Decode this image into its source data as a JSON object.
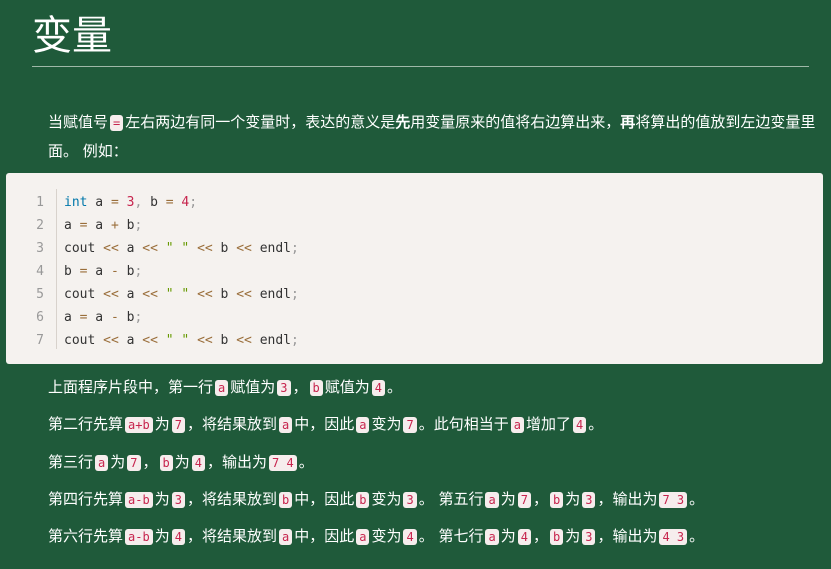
{
  "title": "变量",
  "intro": {
    "t1": "当赋值号",
    "code_eq": "=",
    "t2": "左右两边有同一个变量时，表达的意义是",
    "bold1": "先",
    "t3": "用变量原来的值将右边算出来，",
    "bold2": "再",
    "t4": "将算出的值放到左边变量里面。 例如："
  },
  "code_block": {
    "line_numbers": [
      "1",
      "2",
      "3",
      "4",
      "5",
      "6",
      "7"
    ],
    "lines": [
      "int a = 3, b = 4;",
      "a = a + b;",
      "cout << a << \" \" << b << endl;",
      "b = a - b;",
      "cout << a << \" \" << b << endl;",
      "a = a - b;",
      "cout << a << \" \" << b << endl;"
    ]
  },
  "explanations": {
    "p1": [
      "上面程序片段中，第一行",
      "a",
      "赋值为",
      "3",
      "，",
      "b",
      "赋值为",
      "4",
      "。"
    ],
    "p2": [
      "第二行先算",
      "a+b",
      "为",
      "7",
      "，将结果放到",
      "a",
      "中，因此",
      "a",
      "变为",
      "7",
      "。此句相当于",
      "a",
      "增加了",
      "4",
      "。"
    ],
    "p3": [
      "第三行",
      "a",
      "为",
      "7",
      "，",
      "b",
      "为",
      "4",
      "，输出为",
      "7 4",
      "。"
    ],
    "p4": [
      "第四行先算",
      "a-b",
      "为",
      "3",
      "，将结果放到",
      "b",
      "中，因此",
      "b",
      "变为",
      "3",
      "。 第五行",
      "a",
      "为",
      "7",
      "，",
      "b",
      "为",
      "3",
      "，输出为",
      "7 3",
      "。"
    ],
    "p5": [
      "第六行先算",
      "a-b",
      "为",
      "4",
      "，将结果放到",
      "a",
      "中，因此",
      "a",
      "变为",
      "4",
      "。 第七行",
      "a",
      "为",
      "4",
      "，",
      "b",
      "为",
      "3",
      "，输出为",
      "4 3",
      "。"
    ]
  },
  "colors": {
    "background": "#1f5a3a",
    "inline_code_text": "#c7254e",
    "inline_code_bg": "#f6eded",
    "keyword": "#0077aa"
  }
}
